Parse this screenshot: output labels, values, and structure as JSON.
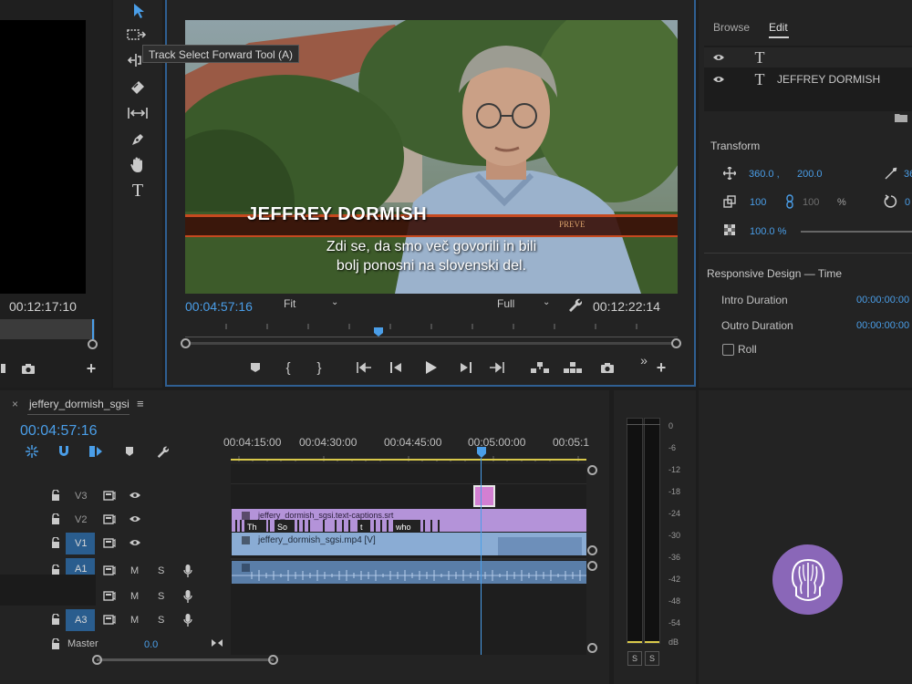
{
  "source_monitor": {
    "timecode": "00:12:17:10"
  },
  "tools": {
    "tooltip": "Track Select Forward Tool (A)"
  },
  "program_monitor": {
    "current_time": "00:04:57:16",
    "fit_label": "Fit",
    "quality_label": "Full",
    "duration": "00:12:22:14",
    "lower_third_name": "JEFFREY DORMISH",
    "lower_third_tag": "PREVE",
    "subtitle_line1": "Zdi se, da smo več govorili in bili",
    "subtitle_line2": "bolj ponosni na slovenski del."
  },
  "egp": {
    "tab_browse": "Browse",
    "tab_edit": "Edit",
    "layer_text": "JEFFREY DORMISH",
    "transform_title": "Transform",
    "pos_x": "360.0 ,",
    "pos_y": "200.0",
    "scale": "100",
    "scale_linked": "100",
    "percent": "%",
    "opacity": "100.0 %",
    "rot_partial": "36",
    "rot_partial2": "0",
    "responsive_title": "Responsive Design — Time",
    "intro_label": "Intro Duration",
    "intro_value": "00:00:00:00",
    "outro_label": "Outro Duration",
    "outro_value": "00:00:00:00",
    "roll_label": "Roll"
  },
  "timeline": {
    "tab_close": "×",
    "sequence_name": "jeffery_dormish_sgsi",
    "menu": "≡",
    "timecode": "00:04:57:16",
    "ruler": [
      "00:04:15:00",
      "00:04:30:00",
      "00:04:45:00",
      "00:05:00:00",
      "00:05:1"
    ],
    "tracks": {
      "v3": "V3",
      "v2": "V2",
      "v1": "V1",
      "a1": "A1",
      "a3": "A3",
      "m": "M",
      "s": "S",
      "master": "Master",
      "master_val": "0.0"
    },
    "clips": {
      "caption_name": "jeffery_dormish_sgsi.text-captions.srt",
      "cap1": "Th",
      "cap2": "So",
      "cap3": "t",
      "cap4": "who",
      "video_name": "jeffery_dormish_sgsi.mp4 [V]"
    }
  },
  "meter": {
    "scale": [
      "0",
      "-6",
      "-12",
      "-18",
      "-24",
      "-30",
      "-36",
      "-42",
      "-48",
      "-54",
      "dB"
    ],
    "solo_left": "S",
    "solo_right": "S"
  },
  "colors": {
    "accent_blue": "#4a9ee8",
    "caption_clip": "#b493d9",
    "video_clip": "#8aacd4",
    "audio_clip": "#6a8fb8",
    "playhead": "#4a9ee8",
    "logo_bg": "#8a67b8"
  }
}
